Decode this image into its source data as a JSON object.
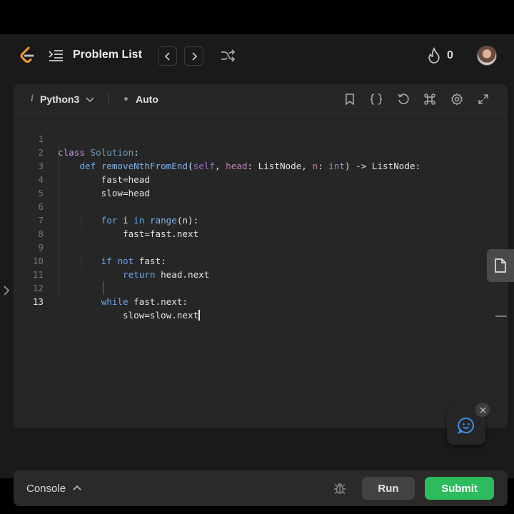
{
  "nav": {
    "title": "Problem List",
    "streak_count": "0"
  },
  "toolbar": {
    "language_prefix": "i",
    "language": "Python3",
    "mode": "Auto"
  },
  "code": {
    "lines": [
      {
        "n": "1",
        "text": "class Solution:"
      },
      {
        "n": "2",
        "text": "    def removeNthFromEnd(self, head: ListNode, n: int) -> ListNode:"
      },
      {
        "n": "3",
        "text": "        fast=head"
      },
      {
        "n": "4",
        "text": "        slow=head"
      },
      {
        "n": "5",
        "text": ""
      },
      {
        "n": "6",
        "text": "        for i in range(n):"
      },
      {
        "n": "7",
        "text": "            fast=fast.next"
      },
      {
        "n": "8",
        "text": ""
      },
      {
        "n": "9",
        "text": "        if not fast:"
      },
      {
        "n": "10",
        "text": "            return head.next"
      },
      {
        "n": "11",
        "text": ""
      },
      {
        "n": "12",
        "text": "        while fast.next:"
      },
      {
        "n": "13",
        "text": "            slow=slow.next"
      }
    ],
    "active_line": "13"
  },
  "console": {
    "label": "Console",
    "run_label": "Run",
    "submit_label": "Submit"
  },
  "colors": {
    "submit": "#2cbb5d",
    "keyword": "#6aa8f0",
    "background": "#1a1a1a",
    "editor": "#262626"
  },
  "icons": {
    "logo": "leetcode-logo",
    "list": "list-icon",
    "prev": "chevron-left-icon",
    "next": "chevron-right-icon",
    "shuffle": "shuffle-icon",
    "streak": "flame-icon",
    "bookmark": "bookmark-icon",
    "braces": "braces-icon",
    "reset": "reset-icon",
    "shortcuts": "command-icon",
    "settings": "gear-icon",
    "fullscreen": "expand-icon",
    "notes": "note-icon",
    "feedback": "smile-icon",
    "debug": "bug-icon"
  }
}
